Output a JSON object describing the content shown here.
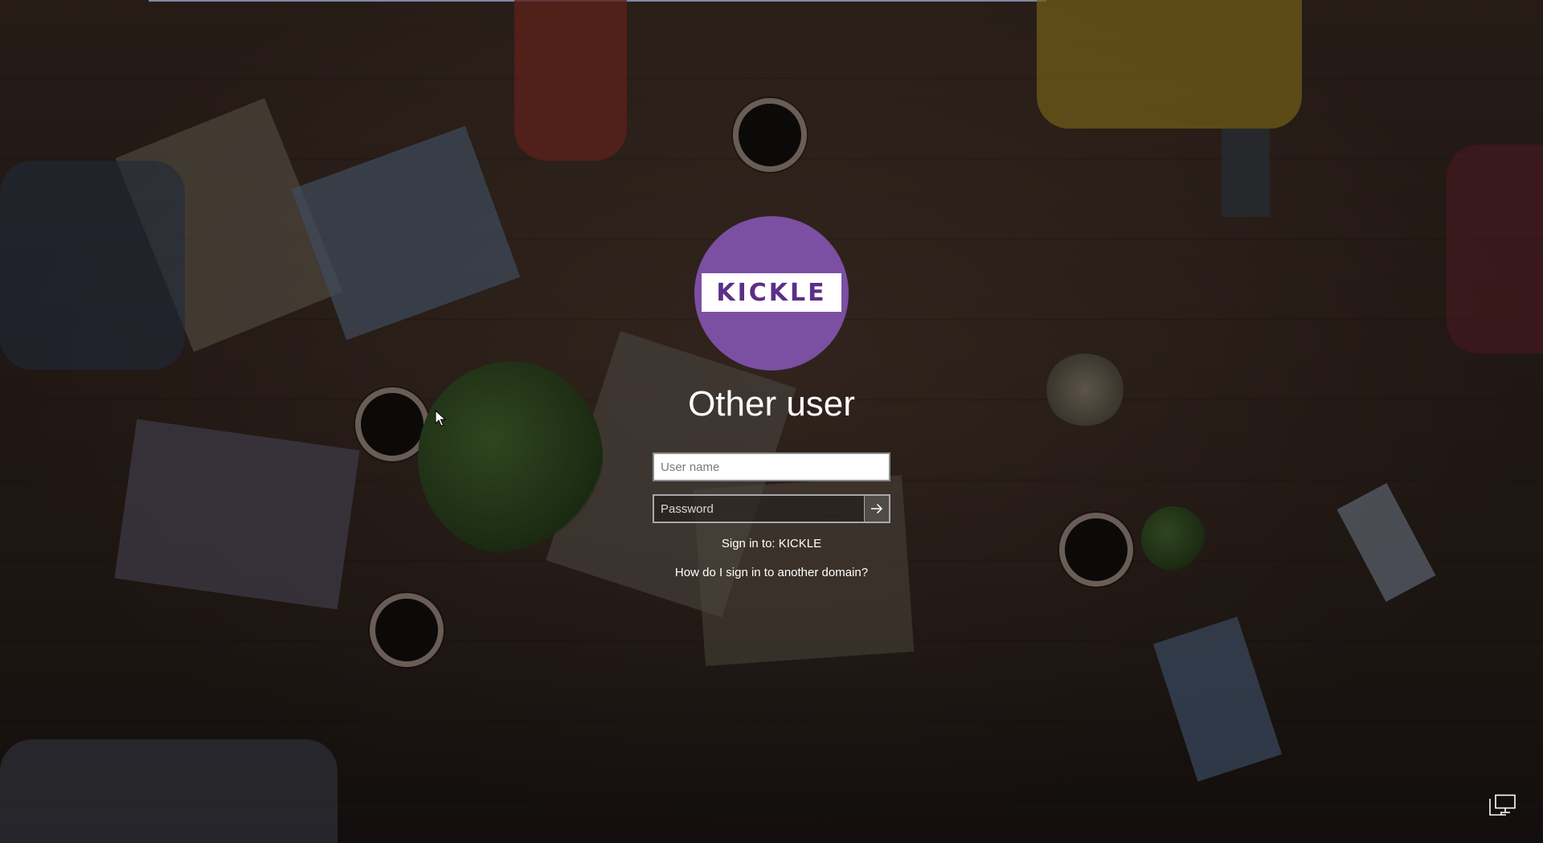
{
  "app": {
    "logo_text": "KICKLE",
    "logo_color": "#7b4fa2"
  },
  "login": {
    "title": "Other user",
    "username_placeholder": "User name",
    "username_value": "",
    "password_placeholder": "Password",
    "password_value": "",
    "submit_icon": "arrow-right-icon",
    "signin_to_label": "Sign in to: KICKLE",
    "other_domain_link": "How do I sign in to another domain?"
  },
  "system_tray": {
    "network_icon": "network-icon"
  }
}
